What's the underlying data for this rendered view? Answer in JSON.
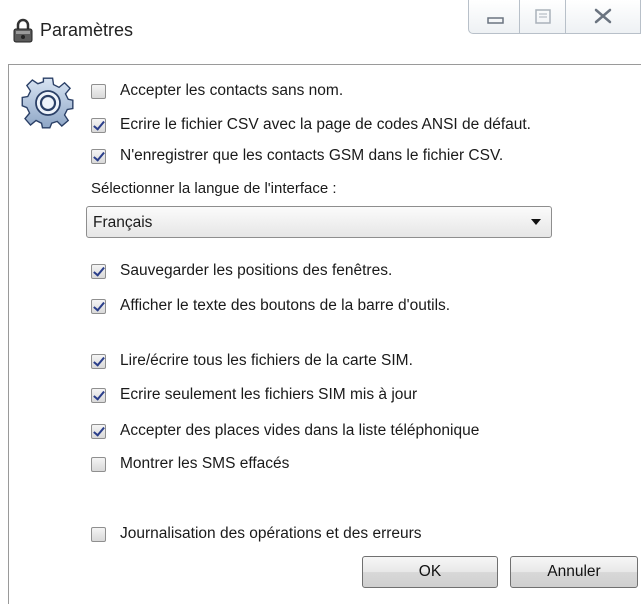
{
  "window": {
    "title": "Paramètres",
    "icon": "lock-app-icon",
    "controls": [
      "minimize-icon",
      "maximize-icon",
      "close-icon"
    ]
  },
  "options": [
    {
      "label": "Accepter les contacts sans nom.",
      "checked": false
    },
    {
      "label": "Ecrire le fichier CSV avec la page de codes ANSI de défaut.",
      "checked": true
    },
    {
      "label": "N'enregistrer que les contacts GSM dans le fichier CSV.",
      "checked": true
    }
  ],
  "language": {
    "label": "Sélectionner la langue de l'interface :",
    "selected": "Français"
  },
  "window_options": [
    {
      "label": "Sauvegarder les positions des fenêtres.",
      "checked": true
    },
    {
      "label": "Afficher le texte des boutons de la barre d'outils.",
      "checked": true
    }
  ],
  "sim_options": [
    {
      "label": "Lire/écrire tous les fichiers de la carte SIM.",
      "checked": true
    },
    {
      "label": "Ecrire seulement les fichiers SIM mis à jour",
      "checked": true
    },
    {
      "label": "Accepter des places vides dans la liste téléphonique",
      "checked": true
    },
    {
      "label": "Montrer les SMS effacés",
      "checked": false
    }
  ],
  "log_option": {
    "label": "Journalisation des opérations et des erreurs",
    "checked": false
  },
  "buttons": {
    "ok": "OK",
    "cancel": "Annuler"
  },
  "colors": {
    "check": "#2a3e8a",
    "border": "#8f8f8f"
  }
}
